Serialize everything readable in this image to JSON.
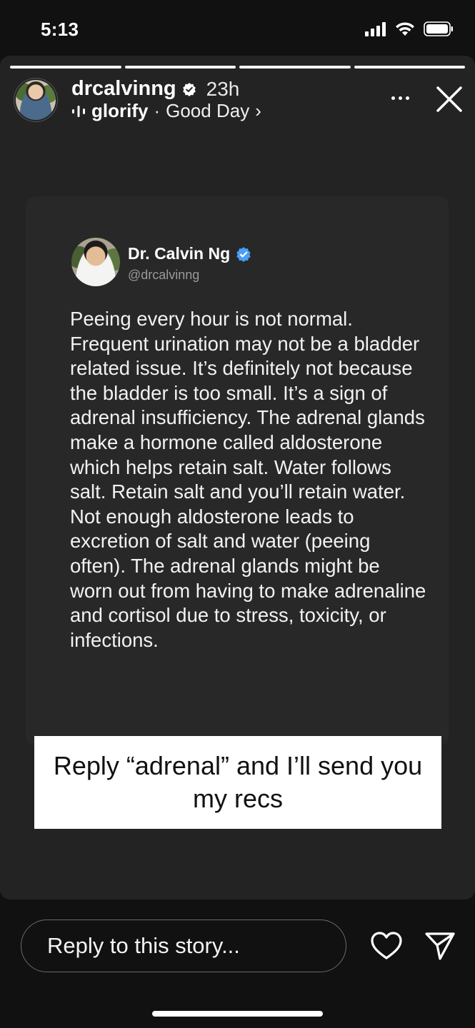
{
  "status_bar": {
    "time": "5:13"
  },
  "story": {
    "progress_segments": 4,
    "progress_done": 3,
    "author": {
      "username": "drcalvinng",
      "time_ago": "23h",
      "music_artist": "glorify",
      "music_separator": "·",
      "music_title": "Good Day",
      "music_chevron": "›"
    }
  },
  "card": {
    "name": "Dr. Calvin Ng",
    "handle": "@drcalvinng",
    "body": "Peeing every hour is not normal. Frequent urination may not be a bladder related issue. It’s definitely not because the bladder is too small. It’s a sign of adrenal insufficiency. The adrenal glands make a hormone called aldosterone which helps retain salt. Water follows salt. Retain salt and you’ll retain water. Not enough aldosterone leads to excretion of salt and water (peeing often). The adrenal glands might be worn out from having to make adrenaline and cortisol due to stress, toxicity, or infections."
  },
  "sticker": {
    "text": "Reply “adrenal” and I’ll send you my recs"
  },
  "reply": {
    "placeholder": "Reply to this story..."
  },
  "colors": {
    "verified": "#4a9ff5",
    "background": "#111111",
    "story_bg": "#232323"
  }
}
